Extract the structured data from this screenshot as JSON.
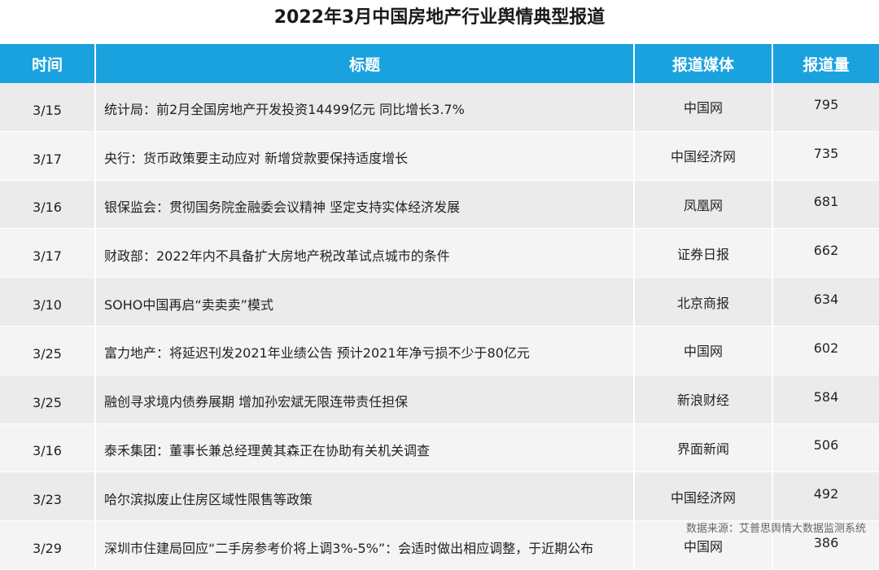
{
  "title": "2022年3月中国房地产行业舆情典型报道",
  "table": {
    "headers": [
      "时间",
      "标题",
      "报道媒体",
      "报道量"
    ],
    "rows": [
      {
        "date": "3/15",
        "headline": "统计局：前2月全国房地产开发投资14499亿元 同比增长3.7%",
        "media": "中国网",
        "count": "795"
      },
      {
        "date": "3/17",
        "headline": "央行：货币政策要主动应对 新增贷款要保持适度增长",
        "media": "中国经济网",
        "count": "735"
      },
      {
        "date": "3/16",
        "headline": "银保监会：贯彻国务院金融委会议精神 坚定支持实体经济发展",
        "media": "凤凰网",
        "count": "681"
      },
      {
        "date": "3/17",
        "headline": "财政部：2022年内不具备扩大房地产税改革试点城市的条件",
        "media": "证券日报",
        "count": "662"
      },
      {
        "date": "3/10",
        "headline": "SOHO中国再启“卖卖卖”模式",
        "media": "北京商报",
        "count": "634"
      },
      {
        "date": "3/25",
        "headline": "富力地产：将延迟刊发2021年业绩公告 预计2021年净亏损不少于80亿元",
        "media": "中国网",
        "count": "602"
      },
      {
        "date": "3/25",
        "headline": "融创寻求境内债券展期 增加孙宏斌无限连带责任担保",
        "media": "新浪财经",
        "count": "584"
      },
      {
        "date": "3/16",
        "headline": "泰禾集团：董事长兼总经理黄其森正在协助有关机关调查",
        "media": "界面新闻",
        "count": "506"
      },
      {
        "date": "3/23",
        "headline": "哈尔滨拟废止住房区域性限售等政策",
        "media": "中国经济网",
        "count": "492"
      },
      {
        "date": "3/29",
        "headline": "深圳市住建局回应“二手房参考价将上调3%-5%”：会适时做出相应调整，于近期公布",
        "media": "中国网",
        "count": "386"
      }
    ]
  },
  "source": "数据来源：艾普思舆情大数据监测系统",
  "colors": {
    "header_bg": "#1aa2df",
    "row_odd": "#ebebeb",
    "row_even": "#f4f4f4"
  }
}
